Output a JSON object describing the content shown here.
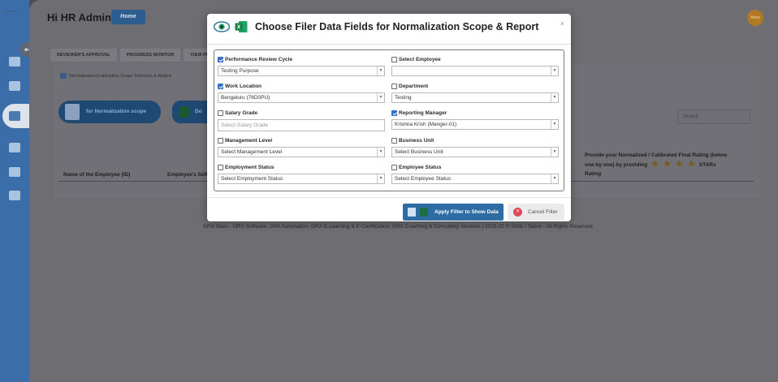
{
  "sidebar": {
    "logo_text": "g·lorion",
    "icons": [
      "collapse-icon",
      "dashboard-icon",
      "book-icon",
      "team-icon",
      "book-icon",
      "report-icon",
      "settings-icon"
    ]
  },
  "header": {
    "greeting": "Hi HR Admin",
    "home_label": "Home",
    "avatar_text": "Hors"
  },
  "tabs": [
    "REVIEWER'S APPROVAL",
    "PROGRESS MONITOR",
    "VIEW PER"
  ],
  "background": {
    "section_title": "Normalization/Calibration Scope Selection & Report",
    "scope_button": "for Normalization scope",
    "download_button": "Do",
    "search_placeholder": "Search",
    "columns": [
      "Name of the Employee (ID)",
      "Employee's Self"
    ],
    "rating_note_1": "Provide your Normalized / Calibrated Final Rating (below",
    "rating_note_2": "one by one) by providing",
    "rating_note_stars": "STARs",
    "rating_note_3": "Rating",
    "footer": "GRX Stars - GRX Software, GPA Automation, GRX E-Learning & E-Certification, GRX Coaching & Consulting Services | 2015-22 © Skills / Talent - All Rights Reserved."
  },
  "modal": {
    "title": "Choose Filer Data Fields for Normalization Scope & Report",
    "close": "×",
    "fields": [
      {
        "label": "Performance Review Cycle",
        "checked": true,
        "value": "Testing Purpose",
        "kind": "select"
      },
      {
        "label": "Select Employee",
        "checked": false,
        "value": "",
        "kind": "select"
      },
      {
        "label": "Work Location",
        "checked": true,
        "value": "Bengaluru (76D0PU)",
        "kind": "select"
      },
      {
        "label": "Department",
        "checked": false,
        "value": "Testing",
        "kind": "select"
      },
      {
        "label": "Salary Grade",
        "checked": false,
        "placeholder": "Select Salary Grade",
        "kind": "input"
      },
      {
        "label": "Reporting Manager",
        "checked": true,
        "value": "Krishna Krish (Manger-01)",
        "kind": "select"
      },
      {
        "label": "Management Level",
        "checked": false,
        "value": "Select Management Level",
        "kind": "select"
      },
      {
        "label": "Business Unit",
        "checked": false,
        "value": "Select Business Unit",
        "kind": "select"
      },
      {
        "label": "Employment Status",
        "checked": false,
        "value": "Select Employment Status",
        "kind": "select"
      },
      {
        "label": "Employee Status",
        "checked": false,
        "value": "Select Employee Status",
        "kind": "select"
      }
    ],
    "apply_label": "Apply Filter to Show Data",
    "cancel_label": "Cancel Filter"
  },
  "colors": {
    "sidebar": "#3b6ea8",
    "primary_button": "#2f6ca4",
    "checkbox_checked": "#2f6fc7",
    "cancel_icon": "#e0455a",
    "overlay": "#6d6d72"
  }
}
